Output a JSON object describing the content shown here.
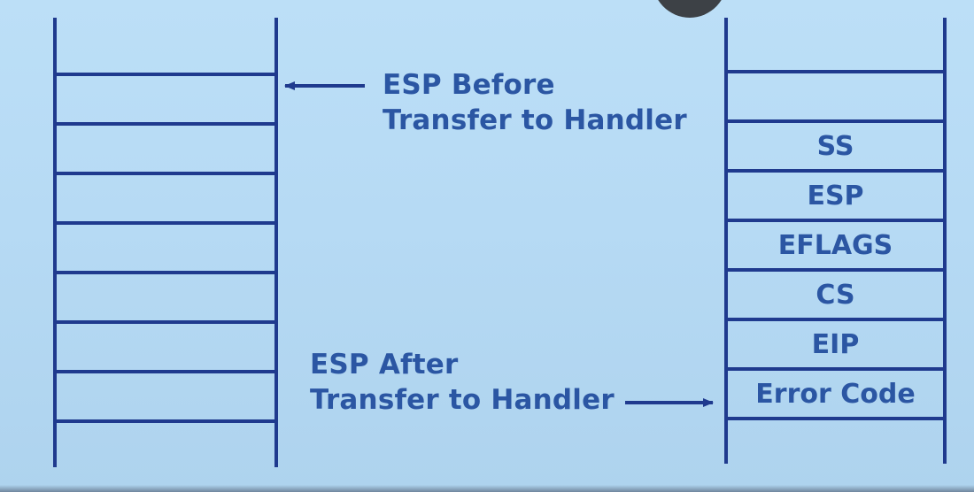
{
  "colors": {
    "stroke": "#1f3a8e",
    "text": "#2b56a3",
    "background": "#b8dbf5"
  },
  "labels": {
    "esp_before_line1": "ESP Before",
    "esp_before_line2": "Transfer to Handler",
    "esp_after_line1": "ESP After",
    "esp_after_line2": "Transfer to Handler"
  },
  "right_stack_entries": [
    "SS",
    "ESP",
    "EFLAGS",
    "CS",
    "EIP",
    "Error Code"
  ]
}
